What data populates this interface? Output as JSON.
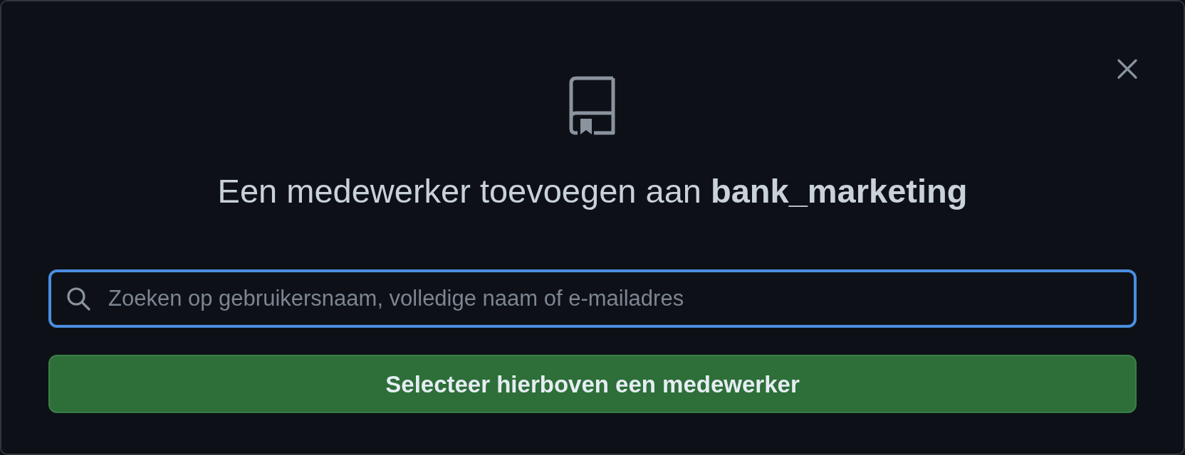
{
  "dialog": {
    "title": "Een medewerker toevoegen aan **bank_marketing**",
    "search": {
      "placeholder": "Zoeken op gebruikersnaam, volledige naam of e-mailadres",
      "focused": true
    },
    "submit_button": "Selecteer hierboven een medewerker"
  }
}
